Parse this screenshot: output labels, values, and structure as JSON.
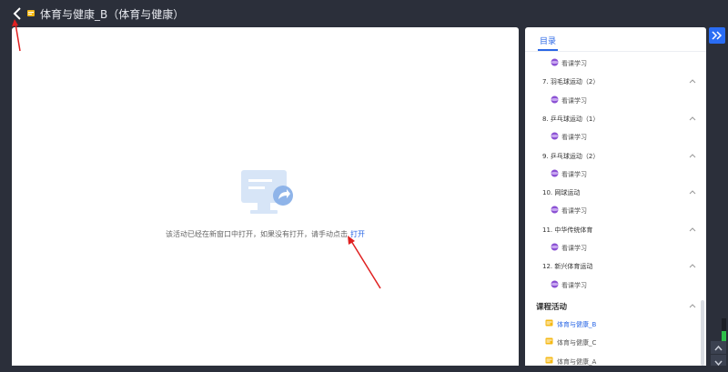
{
  "header": {
    "title": "体育与健康_B（体育与健康）"
  },
  "main": {
    "message": "该活动已经在新窗口中打开，如果没有打开，请手动点击",
    "open_link": "打开"
  },
  "sidebar": {
    "tab_label": "目录",
    "items": [
      {
        "type": "activity",
        "label": "看课学习"
      },
      {
        "type": "chapter",
        "label": "7. 羽毛球运动（2）"
      },
      {
        "type": "activity",
        "label": "看课学习"
      },
      {
        "type": "chapter",
        "label": "8. 乒乓球运动（1）"
      },
      {
        "type": "activity",
        "label": "看课学习"
      },
      {
        "type": "chapter",
        "label": "9. 乒乓球运动（2）"
      },
      {
        "type": "activity",
        "label": "看课学习"
      },
      {
        "type": "chapter",
        "label": "10. 网球运动"
      },
      {
        "type": "activity",
        "label": "看课学习"
      },
      {
        "type": "chapter",
        "label": "11. 中华传统体育"
      },
      {
        "type": "activity",
        "label": "看课学习"
      },
      {
        "type": "chapter",
        "label": "12. 新兴体育运动"
      },
      {
        "type": "activity",
        "label": "看课学习"
      }
    ],
    "course_section": {
      "title": "课程活动",
      "items": [
        {
          "label": "体育与健康_B",
          "active": true
        },
        {
          "label": "体育与健康_C",
          "active": false
        },
        {
          "label": "体育与健康_A",
          "active": false
        }
      ]
    }
  },
  "colors": {
    "accent": "#2a67e6",
    "annotation_arrow": "#e02020",
    "topbar_bg": "#2b2f3a"
  },
  "volume_level": 0.55
}
